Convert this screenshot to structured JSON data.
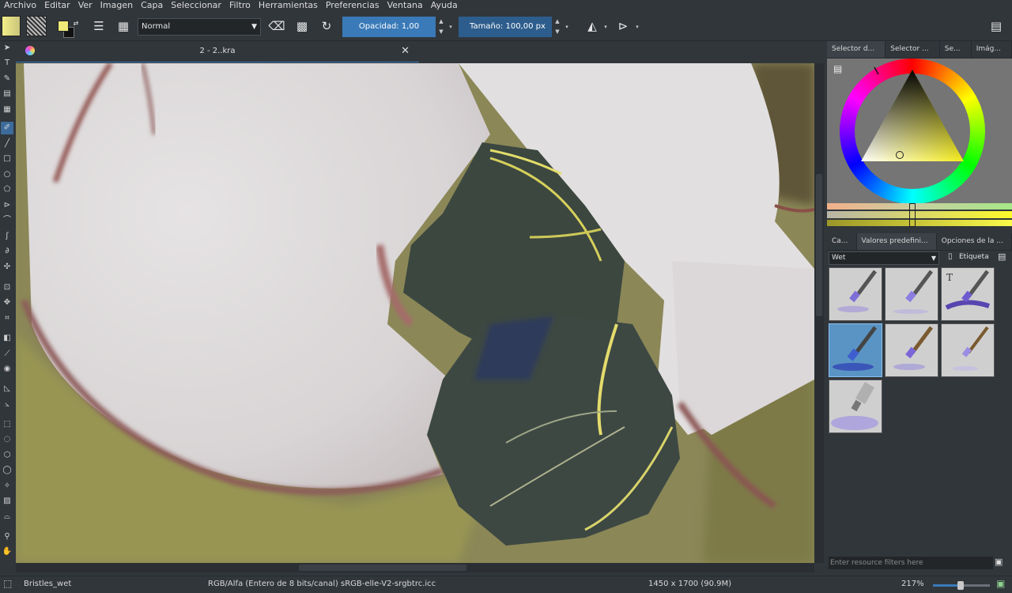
{
  "menu": [
    "Archivo",
    "Editar",
    "Ver",
    "Imagen",
    "Capa",
    "Seleccionar",
    "Filtro",
    "Herramientas",
    "Preferencias",
    "Ventana",
    "Ayuda"
  ],
  "toolbar": {
    "blend_mode": "Normal",
    "opacity_label": "Opacidad:",
    "opacity_value": "1,00",
    "size_label": "Tamaño:",
    "size_value": "100,00 px"
  },
  "document": {
    "tab_title": "2 - 2..kra"
  },
  "dock": {
    "top_tabs": [
      "Selector d...",
      "Selector ...",
      "Se...",
      "Imág..."
    ],
    "mid_tabs": [
      "Ca...",
      "Valores predefini...",
      "Opciones de la ..."
    ],
    "preset_group": "Wet",
    "tag_label": "Etiqueta",
    "filter_placeholder": "Enter resource filters here"
  },
  "status": {
    "brush": "Bristles_wet",
    "color_space": "RGB/Alfa (Entero de 8 bits/canal)  sRGB-elle-V2-srgbtrc.icc",
    "image_size": "1450 x 1700 (90.9M)",
    "zoom": "217%"
  },
  "colors": {
    "foreground": "#f0ea78",
    "accent": "#3a7ab8",
    "panel": "#31363b"
  }
}
